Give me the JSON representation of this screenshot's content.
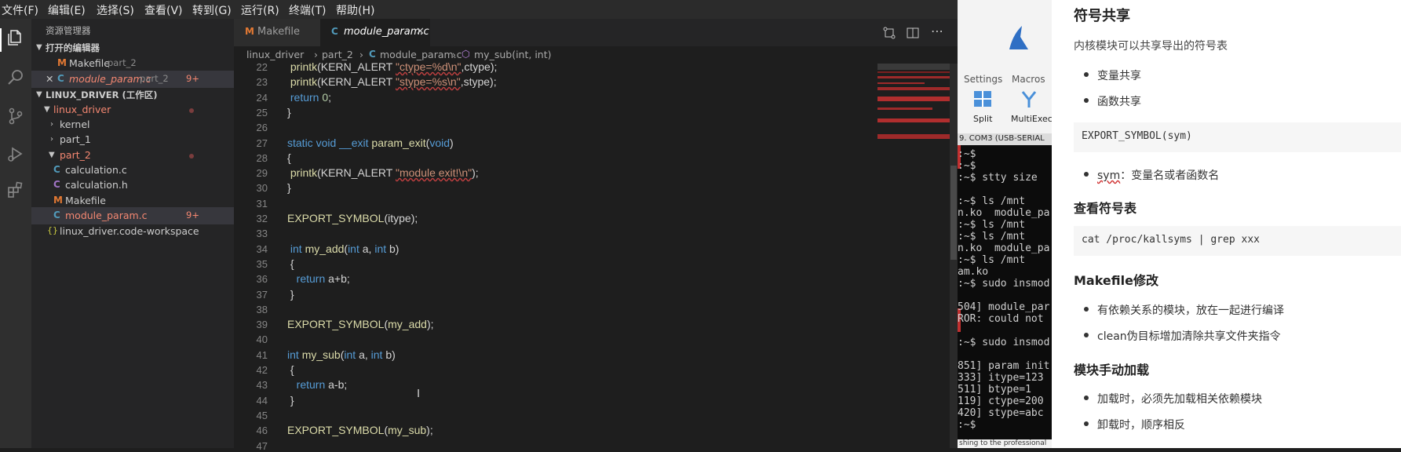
{
  "menu": [
    "文件(F)",
    "编辑(E)",
    "选择(S)",
    "查看(V)",
    "转到(G)",
    "运行(R)",
    "终端(T)",
    "帮助(H)"
  ],
  "sidebar": {
    "title": "资源管理器",
    "open_editors": "打开的编辑器",
    "open_items": [
      {
        "name": "Makefile",
        "hint": "part_2"
      },
      {
        "name": "module_param.c",
        "hint": "part_2",
        "badge": "9+"
      }
    ],
    "workspace": "LINUX_DRIVER (工作区)",
    "tree": {
      "linux_driver": "linux_driver",
      "kernel": "kernel",
      "part_1": "part_1",
      "part_2": "part_2",
      "files": [
        "calculation.c",
        "calculation.h",
        "Makefile",
        "module_param.c"
      ],
      "badge": "9+",
      "ws_file": "linux_driver.code-workspace"
    }
  },
  "tabs": [
    "Makefile",
    "module_param.c"
  ],
  "breadcrumb": [
    "linux_driver",
    "part_2",
    "module_param.c",
    "my_sub(int, int)"
  ],
  "editor": {
    "lines": [
      {
        "n": "22",
        "t": " printk(KERN_ALERT \"ctype=%d\\n\",ctype);"
      },
      {
        "n": "23",
        "t": " printk(KERN_ALERT \"stype=%s\\n\",stype);"
      },
      {
        "n": "24",
        "t": " return 0;"
      },
      {
        "n": "25",
        "t": "}"
      },
      {
        "n": "26",
        "t": ""
      },
      {
        "n": "27",
        "t": "static void __exit param_exit(void)"
      },
      {
        "n": "28",
        "t": "{"
      },
      {
        "n": "29",
        "t": " printk(KERN_ALERT \"module exit!\\n\");"
      },
      {
        "n": "30",
        "t": "}"
      },
      {
        "n": "31",
        "t": ""
      },
      {
        "n": "32",
        "t": "EXPORT_SYMBOL(itype);"
      },
      {
        "n": "33",
        "t": ""
      },
      {
        "n": "34",
        "t": " int my_add(int a, int b)"
      },
      {
        "n": "35",
        "t": " {"
      },
      {
        "n": "36",
        "t": "   return a+b;"
      },
      {
        "n": "37",
        "t": " }"
      },
      {
        "n": "38",
        "t": ""
      },
      {
        "n": "39",
        "t": "EXPORT_SYMBOL(my_add);"
      },
      {
        "n": "40",
        "t": ""
      },
      {
        "n": "41",
        "t": "int my_sub(int a, int b)"
      },
      {
        "n": "42",
        "t": " {"
      },
      {
        "n": "43",
        "t": "   return a-b;"
      },
      {
        "n": "44",
        "t": " }"
      },
      {
        "n": "45",
        "t": ""
      },
      {
        "n": "46",
        "t": "EXPORT_SYMBOL(my_sub);"
      },
      {
        "n": "47",
        "t": ""
      }
    ]
  },
  "midapp": {
    "menu": [
      "Settings",
      "Macros"
    ],
    "buttons": [
      "Split",
      "MultiExec"
    ],
    "tab_title": "9. COM3  (USB-SERIAL",
    "terminal": [
      ":~$",
      ":~$",
      ":~$ stty size",
      "",
      ":~$ ls /mnt",
      "n.ko  module_pa",
      ":~$ ls /mnt",
      ":~$ ls /mnt",
      "n.ko  module_pa",
      ":~$ ls /mnt",
      "am.ko",
      ":~$ sudo insmod",
      "",
      "504] module_par",
      "ROR: could not",
      "",
      ":~$ sudo insmod",
      "",
      "851] param init",
      "333] itype=123",
      "511] btype=1",
      "119] ctype=200",
      "420] stype=abc",
      ":~$ "
    ],
    "footer": "shing to the professional"
  },
  "doc": {
    "h_symbols": "符号共享",
    "p_symbols": "内核模块可以共享导出的符号表",
    "li_var": "变量共享",
    "li_func": "函数共享",
    "code_export": "EXPORT_SYMBOL(sym)",
    "li_sym_term": "sym",
    "li_sym_desc": "：变量名或者函数名",
    "h_view": "查看符号表",
    "code_kallsyms": "cat /proc/kallsyms | grep xxx",
    "h_makefile": "Makefile修改",
    "li_dep": "有依赖关系的模块，放在一起进行编译",
    "li_clean": "clean伪目标增加清除共享文件夹指令",
    "h_manual": "模块手动加载",
    "li_load": "加载时，必须先加载相关依赖模块",
    "li_unload": "卸载时，顺序相反"
  },
  "colors": {
    "accent": "#007acc",
    "error": "#f48771",
    "selection": "#264f78"
  }
}
